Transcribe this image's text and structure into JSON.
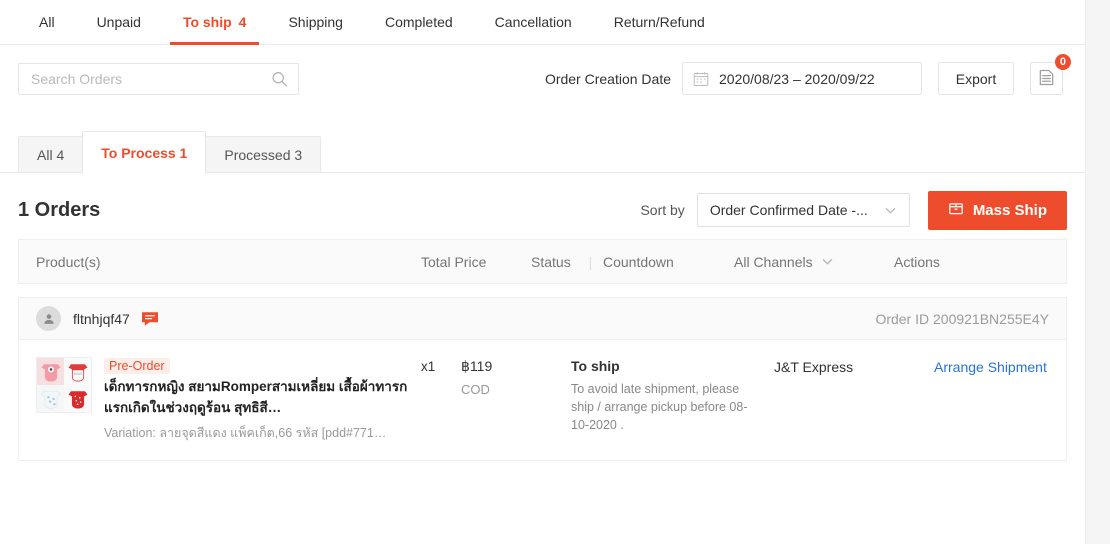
{
  "topnav": {
    "items": [
      {
        "label": "All",
        "count": "",
        "active": false
      },
      {
        "label": "Unpaid",
        "count": "",
        "active": false
      },
      {
        "label": "To ship",
        "count": "4",
        "active": true
      },
      {
        "label": "Shipping",
        "count": "",
        "active": false
      },
      {
        "label": "Completed",
        "count": "",
        "active": false
      },
      {
        "label": "Cancellation",
        "count": "",
        "active": false
      },
      {
        "label": "Return/Refund",
        "count": "",
        "active": false
      }
    ]
  },
  "filterbar": {
    "search_placeholder": "Search Orders",
    "search_value": "",
    "search_icon": "search-icon",
    "date_label": "Order Creation Date",
    "date_value": "2020/08/23 – 2020/09/22",
    "calendar_icon": "calendar-icon",
    "export_label": "Export",
    "list_icon": "document-list-icon",
    "badge_count": "0"
  },
  "subtabs": [
    {
      "label": "All 4",
      "active": false
    },
    {
      "label": "To Process 1",
      "active": true
    },
    {
      "label": "Processed 3",
      "active": false
    }
  ],
  "orders_head": {
    "title": "1 Orders",
    "sort_label": "Sort by",
    "sort_value": "Order Confirmed Date -...",
    "chevron_icon": "chevron-down-icon",
    "mass_ship_label": "Mass Ship",
    "mass_ship_icon": "box-icon"
  },
  "table": {
    "columns": {
      "product": "Product(s)",
      "total_price": "Total Price",
      "status": "Status",
      "separator": "|",
      "countdown": "Countdown",
      "channel": "All Channels",
      "channel_icon": "chevron-down-icon",
      "actions": "Actions"
    }
  },
  "order": {
    "avatar_icon": "user-avatar-icon",
    "buyer_name": "fltnhjqf47",
    "chat_icon": "chat-bubble-icon",
    "order_id": "Order ID 200921BN255E4Y",
    "product": {
      "thumbnail_icon": "product-thumbnail-collage",
      "tag": "Pre-Order",
      "name": "เด็กทารกหญิง สยามRomperสามเหลี่ยม เสื้อผ้าทารกแรกเกิดในช่วงฤดูร้อน สุทธิสี…",
      "variation": "Variation: ลายจุดสีแดง แพ็คเก็ต,66 รหัส [pdd#771…",
      "quantity": "x1"
    },
    "price": "฿119",
    "payment_method": "COD",
    "status_title": "To ship",
    "status_desc": "To avoid late shipment, please ship / arrange pickup before 08-10-2020 .",
    "channel": "J&T Express",
    "action_label": "Arrange Shipment"
  },
  "colors": {
    "accent": "#ee4d2d",
    "link": "#2673dd",
    "text": "#333333",
    "muted": "#999999"
  }
}
